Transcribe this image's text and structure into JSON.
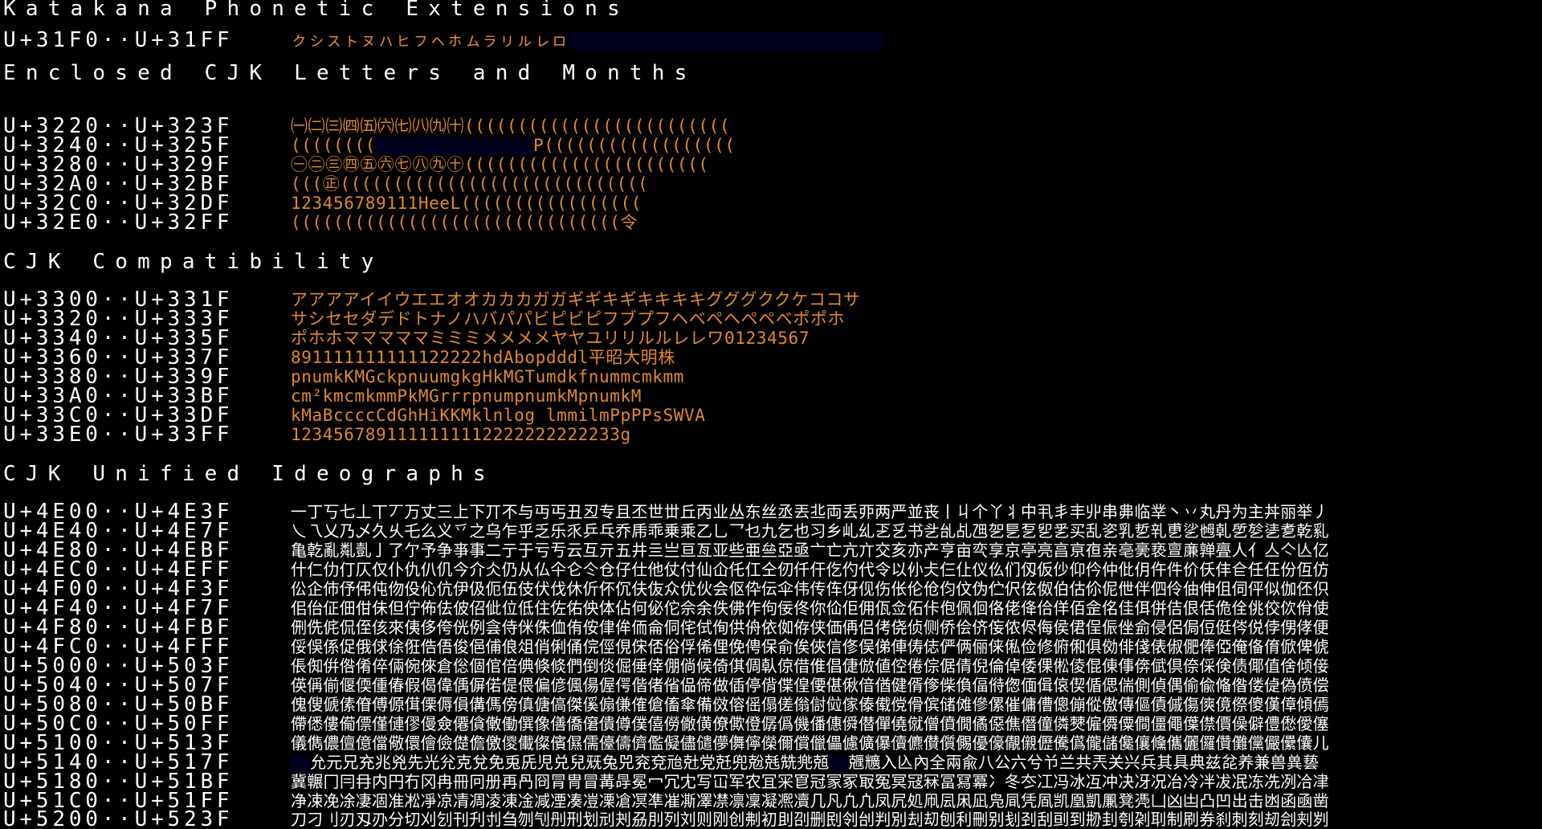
{
  "colors": {
    "background": "#000000",
    "text": "#ffffff",
    "glyph_accent": "#e08a2e",
    "unassigned_block": "#00001e"
  },
  "sections": {
    "katakana": {
      "title": "Katakana Phonetic Extensions",
      "rows": [
        {
          "range": "U+31F0··U+31FF",
          "glyphs": "ㇰㇱㇲㇳㇴㇵㇶㇷㇸㇹㇺㇻㇼㇽㇾㇿ"
        }
      ]
    },
    "enclosed": {
      "title": "Enclosed CJK Letters and Months",
      "rows": [
        {
          "range": "U+3220··U+323F",
          "glyphs": "㈠㈡㈢㈣㈤㈥㈦㈧㈨㈩((((((((((((((((((((((((("
        },
        {
          "range": "U+3240··U+325F",
          "glyphs_a": "((((((((",
          "glyphs_b": "P(((((((((((((((((("
        },
        {
          "range": "U+3280··U+329F",
          "glyphs": "㊀㊁㊂㊃㊄㊅㊆㊇㊈㊉((((((((((((((((((((((("
        },
        {
          "range": "U+32A0··U+32BF",
          "glyphs": "(((㊣((((((((((((((((((((((((((((("
        },
        {
          "range": "U+32C0··U+32DF",
          "glyphs": "123456789111HeeL((((((((((((((((("
        },
        {
          "range": "U+32E0··U+32FF",
          "glyphs": "(((((((((((((((((((((((((((((((令"
        }
      ]
    },
    "compat": {
      "title": "CJK Compatibility",
      "rows": [
        {
          "range": "U+3300··U+331F",
          "glyphs": "アアアアイイウエエオオカカカガガギギキギキキキキグググククケココサ"
        },
        {
          "range": "U+3320··U+333F",
          "glyphs": "サシセセダデドトナノハバパパビピビピフブプフヘベペヘペペベポポホ"
        },
        {
          "range": "U+3340··U+335F",
          "glyphs": "ポホホマママママミミミメメメメヤヤユリリルルレレワ01234567"
        },
        {
          "range": "U+3360··U+337F",
          "glyphs": "891111111111122222hdAbopdddl平昭大明株"
        },
        {
          "range": "U+3380··U+339F",
          "glyphs": "pnumkKMGckpnuumgkgHkMGTumdkfnummcmkmm"
        },
        {
          "range": "U+33A0··U+33BF",
          "glyphs": "cm²kmcmkmmPkMGrrrpnumpnumkMpnumkM"
        },
        {
          "range": "U+33C0··U+33DF",
          "glyphs": "kMaBccccCdGhHiKKMklnlog lmmilmPpPPsSWVA"
        },
        {
          "range": "U+33E0··U+33FF",
          "glyphs": "1234567891111111112222222222233g"
        }
      ]
    },
    "unified": {
      "title": "CJK Unified Ideographs",
      "rows": [
        {
          "range": "U+4E00··U+4E3F",
          "glyphs": "一丁丂七丄丅丆万丈三上下丌不与丏丐丑丒专且丕世丗丘丙业丛东丝丞丟丠両丢丣两严並丧丨丩个丫丬中丮丯丰丱串丳临丵丶丷丸丹为主丼丽举丿"
        },
        {
          "range": "U+4E40··U+4E7F",
          "glyphs": "乀乁乂乃乄久乆乇么义乊之乌乍乎乏乐乑乒乓乔乕乖乗乘乙乚乛乜九乞也习乡乢乣乤乥书乧乨乩乪乫乬乭乮乯买乱乲乳乴乵乶乷乸乹乺乻乼乽乾乿"
        },
        {
          "range": "U+4E80··U+4EBF",
          "glyphs": "亀亁亂亃亄亅了亇予争亊事二亍于亏亐云互亓五井亖亗亘亙亚些亜亝亞亟亠亡亢亣交亥亦产亨亩亪享京亭亮亯亰亱亲亳亴亵亶亷亸亹人亻亼亽亾亿"
        },
        {
          "range": "U+4EC0··U+4EFF",
          "glyphs": "什仁仂仃仄仅仆仇仈仉今介仌仍从仏仐仑仒仓仔仕他仗付仙仚仛仜仝仞仟仠仡仢代令以仦仧仨仩仪仫们仭仮仯仰仱仲仳仴仵件价仸仹仺任仼份仾仿"
        },
        {
          "range": "U+4F00··U+4F3F",
          "glyphs": "伀企伂伃伄伅伆伇伈伉伊伋伌伍伎伏伐休伒伓伔伕伖众优伙会伛伜伝伞伟传伡伢伣伤伥伦伧伨伩伪伫伬伭伮伯估伱伲伳伴伵伶伷伸伹伺伻似伽伾伿"
        },
        {
          "range": "U+4F40··U+4F7F",
          "glyphs": "佀佁佂佃佄佅但佇佈佉佊佋佌位低住佐佑佒体佔何佖佗佘余佚佛作佝佞佟你佡佢佣佤佥佦佧佨佩佪佫佬佭佮佯佰佱佲佳佴併佶佷佸佹佺佻佼佽佾使"
        },
        {
          "range": "U+4F80··U+4FBF",
          "glyphs": "侀侁侂侃侄侅來侇侈侉侊例侌侍侎侏侐侑侒侓侔侕侖侗侘侙侚供侜依侞侟侠価侢侣侤侥侦侧侨侩侪侫侬侭侮侯侰侱侲侳侴侵侶侷侸侹侺侻侼侽侾便"
        },
        {
          "range": "U+4FC0··U+4FFF",
          "glyphs": "俀俁係促俄俅俆俇俈俉俊俋俌俍俎俏俐俑俒俓俔俕俖俗俘俙俚俛俜保俞俟俠信俢俣俤俥俦俧俨俩俪俫俬俭修俯俰俱俲俳俴俵俶俷俸俹俺俻俼俽俾俿"
        },
        {
          "range": "U+5000··U+503F",
          "glyphs": "倀倁倂倃倄倅倆倇倈倉倊個倌倍倎倏倐們倒倓倔倕倖倗倘候倚倛倜倝倞借倠倡倢倣値倥倦倧倨倩倪倫倬倭倮倯倰倱倲倳倴倵倶倷倸倹债倻值倽倾倿"
        },
        {
          "range": "U+5040··U+507F",
          "glyphs": "偀偁偂偃偄偅偆假偈偉偊偋偌偍偎偏偐偑偒偓偔偕偖偗偘偙做偛停偝偞偟偠偡偢偣偤健偦偧偨偩偪偫偬偭偮偯偰偱偲偳側偵偶偷偸偹偺偻偼偽偾偿"
        },
        {
          "range": "U+5080··U+50BF",
          "glyphs": "傀傁傂傃傄傅傆傇傈傉傊傋傌傍傎傏傐傑傒傓傔傕傖傗傘備傚傛傜傝傞傟傠傡傢傣傤傥傦傧储傩傪傫催傭傮傯傰傱傲傳傴債傶傷傸傹傺傻傼傽傾傿"
        },
        {
          "range": "U+50C0··U+50FF",
          "glyphs": "僀僁僂僃僄僅僆僇僈僉僊僋僌働僎像僐僑僒僓僔僕僖僗僘僙僚僛僜僝僞僟僠僡僢僣僤僥僦僧僨僩僪僫僬僭僮僯僰僱僲僳僴僵僶僷僸價僺僻僼僽僾僿"
        },
        {
          "range": "U+5100··U+513F",
          "glyphs": "儀儁儂儃億儅儆儇儈儉儊儋儌儍儎儏儐儑儒儓儔儕儖儗儘儙儚儛儜儝儞償儠儡儢儣儤儥儦儧儨儩優儫儬儭儮儯儰儱儲儳儴儵儶儷儸儹儺儻儼儽儾儿"
        },
        {
          "range": "U+5140··U+517F",
          "glyphs_b": "允元兄充兆兇先光兊克兌免兎兏児兑兒兓兔兕兖兗兘兙党兛兜兝兞兟兠兡",
          "glyphs_c": "兣兤入兦內全兩兪八公六兮兯兰共兲关兴兵其具典兹兺养兼兽兾兿"
        },
        {
          "range": "U+5180··U+51BF",
          "glyphs": "冀冁冂冃冄内円冇冈冉冊冋册再冎冏冐冑冒冓冔冕冖冗冘写冚军农冝冞冟冠冡冢冣冤冥冦冧冨冩冪冫冬冭冮冯冰冱冲决冴况冶冷冸冹冺冻冼冽冾冿"
        },
        {
          "range": "U+51C0··U+51FF",
          "glyphs": "净凁凂凃凄凅准凇凈凉凊凋凌凍凎减凐凑凒凓凔凕凖凗凘凙凚凛凜凝凞凟几凡凢凣凤凥処凧凨凩凪凫凬凭凮凯凰凱凲凳凴凵凶凷凸凹出击凼函凾凿"
        },
        {
          "range": "U+5200··U+523F",
          "glyphs": "刀刁刂刃刄刅分切刈刉刊刋刌刍刎刏刐刑划刓刔刕刖列刘则刚创刜初刞刟删刡刢刣判別刦刧刨利刪别刬刭刮刯到刱刲刳刴刵制刷券刹刺刻刼刽刾刿"
        }
      ]
    }
  }
}
